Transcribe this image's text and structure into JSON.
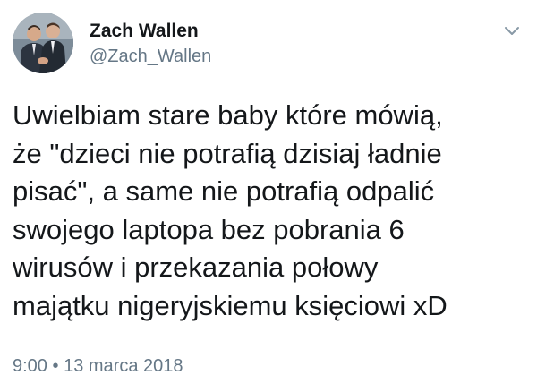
{
  "tweet": {
    "author": {
      "display_name": "Zach Wallen",
      "handle": "@Zach_Wallen"
    },
    "menu_icon": "chevron-down-icon",
    "text_lines": [
      "Uwielbiam stare baby które mówią,",
      "że \"dzieci nie potrafią dzisiaj ładnie",
      "pisać\", a same nie potrafią odpalić",
      "swojego laptopa bez pobrania 6",
      "wirusów i przekazania połowy",
      "majątku nigeryjskiemu księciowi xD"
    ],
    "time": "9:00",
    "separator": "•",
    "date": "13 marca 2018"
  },
  "colors": {
    "text": "#14171a",
    "secondary": "#657786",
    "background": "#ffffff"
  }
}
